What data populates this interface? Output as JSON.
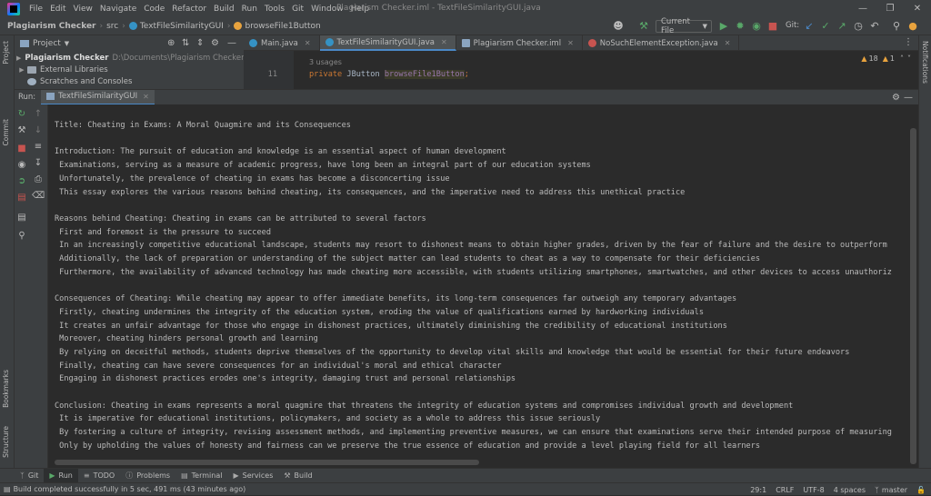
{
  "menu": {
    "items": [
      "File",
      "Edit",
      "View",
      "Navigate",
      "Code",
      "Refactor",
      "Build",
      "Run",
      "Tools",
      "Git",
      "Window",
      "Help"
    ],
    "window_title": "Plagiarism Checker.iml - TextFileSimilarityGUI.java"
  },
  "breadcrumb": {
    "project": "Plagiarism Checker",
    "folder": "src",
    "class": "TextFileSimilarityGUI",
    "member": "browseFile1Button"
  },
  "toolbar": {
    "run_config": "Current File",
    "git_label": "Git:"
  },
  "project_panel": {
    "title": "Project",
    "items": [
      {
        "label": "Plagiarism Checker",
        "path": "D:\\Documents\\Plagiarism Checker"
      },
      {
        "label": "External Libraries",
        "path": ""
      },
      {
        "label": "Scratches and Consoles",
        "path": ""
      }
    ]
  },
  "editor": {
    "tabs": [
      "Main.java",
      "TextFileSimilarityGUI.java",
      "Plagiarism Checker.iml",
      "NoSuchElementException.java"
    ],
    "usages": "3 usages",
    "line_number": "11",
    "code_keyword": "private",
    "code_type": "JButton",
    "code_name": "browseFile1Button",
    "code_end": ";",
    "warnings": "18",
    "weak_warnings": "1"
  },
  "run_panel": {
    "label": "Run:",
    "tab": "TextFileSimilarityGUI",
    "output": [
      "Title: Cheating in Exams: A Moral Quagmire and its Consequences",
      "",
      "Introduction: The pursuit of education and knowledge is an essential aspect of human development",
      " Examinations, serving as a measure of academic progress, have long been an integral part of our education systems",
      " Unfortunately, the prevalence of cheating in exams has become a disconcerting issue",
      " This essay explores the various reasons behind cheating, its consequences, and the imperative need to address this unethical practice",
      "",
      "Reasons behind Cheating: Cheating in exams can be attributed to several factors",
      " First and foremost is the pressure to succeed",
      " In an increasingly competitive educational landscape, students may resort to dishonest means to obtain higher grades, driven by the fear of failure and the desire to outperform",
      " Additionally, the lack of preparation or understanding of the subject matter can lead students to cheat as a way to compensate for their deficiencies",
      " Furthermore, the availability of advanced technology has made cheating more accessible, with students utilizing smartphones, smartwatches, and other devices to access unauthoriz",
      "",
      "Consequences of Cheating: While cheating may appear to offer immediate benefits, its long-term consequences far outweigh any temporary advantages",
      " Firstly, cheating undermines the integrity of the education system, eroding the value of qualifications earned by hardworking individuals",
      " It creates an unfair advantage for those who engage in dishonest practices, ultimately diminishing the credibility of educational institutions",
      " Moreover, cheating hinders personal growth and learning",
      " By relying on deceitful methods, students deprive themselves of the opportunity to develop vital skills and knowledge that would be essential for their future endeavors",
      " Finally, cheating can have severe consequences for an individual's moral and ethical character",
      " Engaging in dishonest practices erodes one's integrity, damaging trust and personal relationships",
      "",
      "Conclusion: Cheating in exams represents a moral quagmire that threatens the integrity of education systems and compromises individual growth and development",
      " It is imperative for educational institutions, policymakers, and society as a whole to address this issue seriously",
      " By fostering a culture of integrity, revising assessment methods, and implementing preventive measures, we can ensure that examinations serve their intended purpose of measuring",
      " Only by upholding the values of honesty and fairness can we preserve the true essence of education and provide a level playing field for all learners"
    ]
  },
  "side_labels": {
    "left_top": "Project",
    "left_commit": "Commit",
    "left_bookmarks": "Bookmarks",
    "left_structure": "Structure",
    "right_notifications": "Notifications"
  },
  "bottom_tabs": [
    "Git",
    "Run",
    "TODO",
    "Problems",
    "Terminal",
    "Services",
    "Build"
  ],
  "status": {
    "message": "Build completed successfully in 5 sec, 491 ms (43 minutes ago)",
    "position": "29:1",
    "line_sep": "CRLF",
    "encoding": "UTF-8",
    "indent": "4 spaces",
    "branch": "master"
  },
  "colors": {
    "background": "#2b2b2b",
    "panel": "#3c3f41",
    "accent": "#4a88c7",
    "keyword": "#cc7832",
    "field": "#9876aa"
  }
}
